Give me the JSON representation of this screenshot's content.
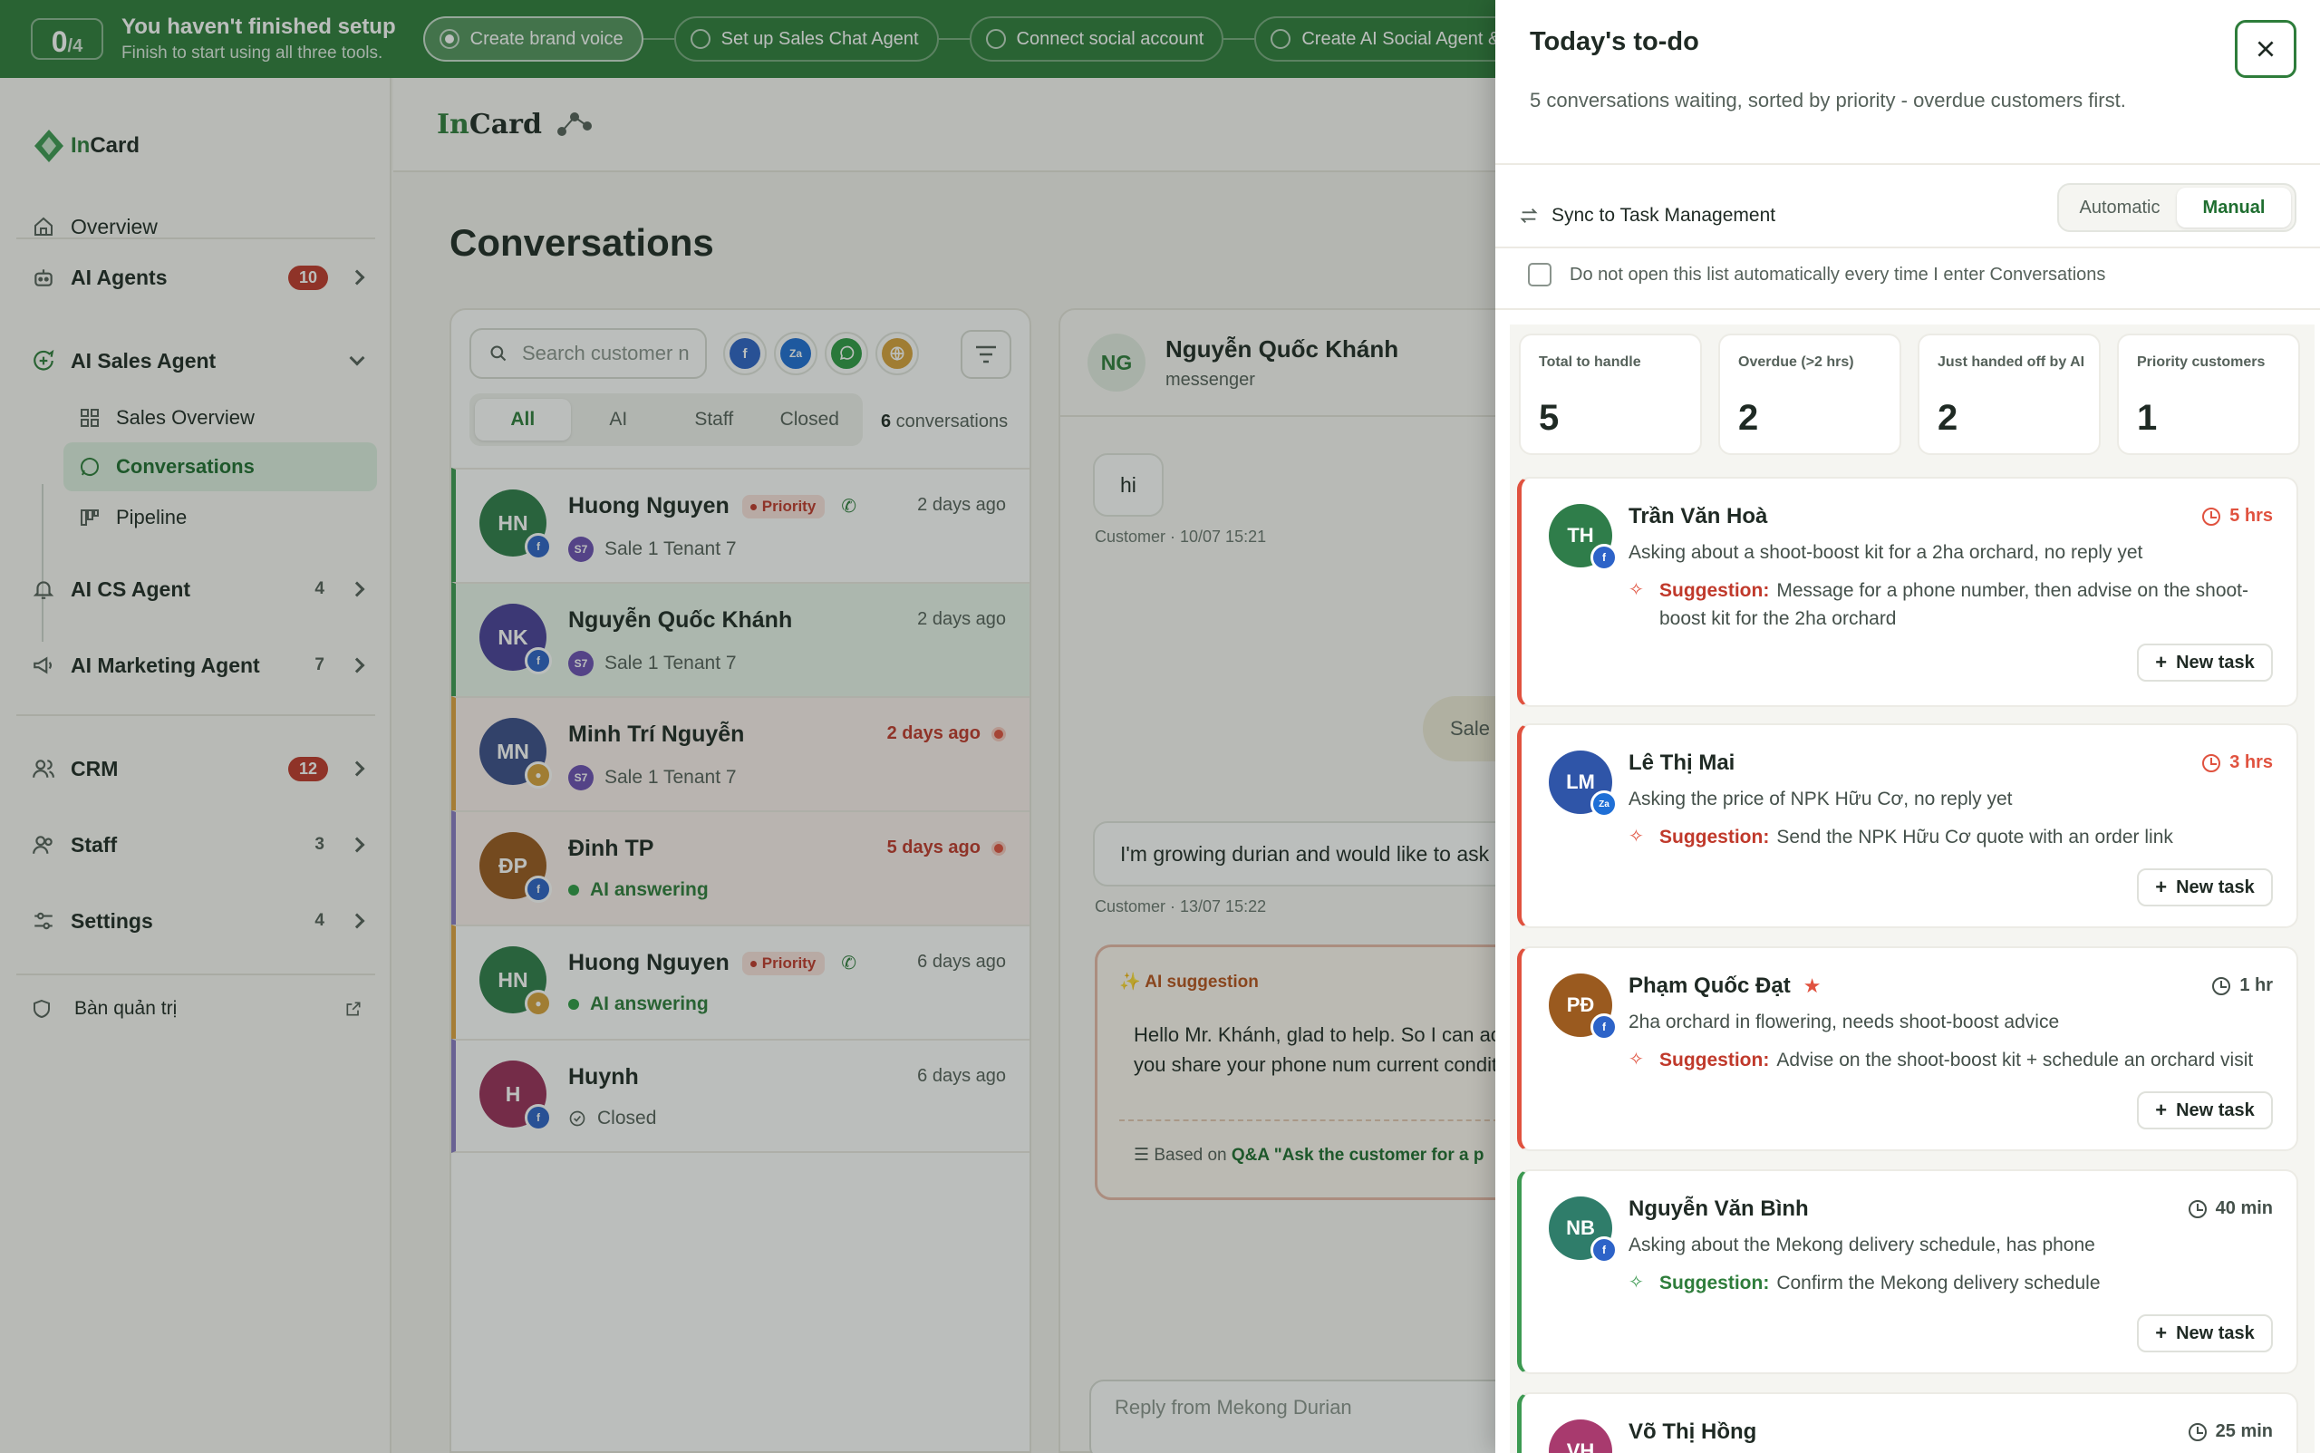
{
  "setup": {
    "count": "0",
    "total": "/4",
    "title": "You haven't finished setup",
    "subtitle": "Finish to start using all three tools.",
    "steps": [
      {
        "label": "Create brand voice",
        "active": true
      },
      {
        "label": "Set up Sales Chat Agent",
        "active": false
      },
      {
        "label": "Connect social account",
        "active": false
      },
      {
        "label": "Create AI Social Agent & ...",
        "active": false
      }
    ]
  },
  "brand": {
    "prefix": "In",
    "suffix": "Card"
  },
  "sidebar": {
    "overview": "Overview",
    "ai_agents": {
      "label": "AI Agents",
      "badge": "10"
    },
    "ai_sales_agent": {
      "label": "AI Sales Agent"
    },
    "sub_items": [
      "Sales Overview",
      "Conversations",
      "Pipeline"
    ],
    "ai_cs_agent": {
      "label": "AI CS Agent",
      "count": "4"
    },
    "ai_marketing_agent": {
      "label": "AI Marketing Agent",
      "count": "7"
    },
    "crm": {
      "label": "CRM",
      "badge": "12"
    },
    "staff": {
      "label": "Staff",
      "count": "3"
    },
    "settings": {
      "label": "Settings",
      "count": "4"
    },
    "admin": "Bàn quản trị"
  },
  "main": {
    "logo_prefix": "In",
    "logo_suffix": "Card",
    "title": "Conversations"
  },
  "list": {
    "search_placeholder": "Search customer n",
    "channels": [
      "f",
      "Za",
      "whatsapp",
      "web"
    ],
    "tabs": [
      "All",
      "AI",
      "Staff",
      "Closed"
    ],
    "active_tab": "All",
    "count_num": "6",
    "count_label": " conversations",
    "items": [
      {
        "initials": "HN",
        "name": "Huong Nguyen",
        "priority": "Priority",
        "time": "2 days ago",
        "sub": "Sale 1 Tenant 7",
        "channel": "f"
      },
      {
        "initials": "NK",
        "name": "Nguyễn Quốc Khánh",
        "priority": "",
        "time": "2 days ago",
        "sub": "Sale 1 Tenant 7",
        "channel": "f"
      },
      {
        "initials": "MN",
        "name": "Minh Trí Nguyễn",
        "priority": "",
        "time": "2 days ago",
        "sub": "Sale 1 Tenant 7",
        "channel": "web"
      },
      {
        "initials": "ĐP",
        "name": "Đinh TP",
        "priority": "",
        "time": "5 days ago",
        "sub": "AI answering",
        "channel": "f"
      },
      {
        "initials": "HN",
        "name": "Huong Nguyen",
        "priority": "Priority",
        "time": "6 days ago",
        "sub": "AI answering",
        "channel": "web"
      },
      {
        "initials": "H",
        "name": "Huynh",
        "priority": "",
        "time": "6 days ago",
        "sub": "Closed",
        "channel": "f"
      }
    ]
  },
  "chat": {
    "initials": "NG",
    "name": "Nguyễn Quốc Khánh",
    "channel": "messenger",
    "msg1": "hi",
    "meta1": "Customer · 10/07 15:21",
    "sale_bubble": "Sale",
    "msg2": "I'm growing durian and would like to ask h",
    "meta2": "Customer · 13/07 15:22",
    "ai_label": "AI suggestion",
    "ai_text": "Hello Mr. Khánh, glad to help. So I can ac orchard, could you share your phone num current condition, even better.",
    "based_prefix": "Based on ",
    "based_link": "Q&A \"Ask the customer for a p",
    "reply_placeholder": "Reply from Mekong Durian"
  },
  "drawer": {
    "title": "Today's to-do",
    "subtitle": "5 conversations waiting, sorted by priority - overdue customers first.",
    "sync_label": "Sync to Task Management",
    "mode_auto": "Automatic",
    "mode_manual": "Manual",
    "checkbox_label": "Do not open this list automatically every time I enter Conversations",
    "stats": [
      {
        "label": "Total to handle",
        "value": "5"
      },
      {
        "label": "Overdue (>2 hrs)",
        "value": "2"
      },
      {
        "label": "Just handed off by AI",
        "value": "2"
      },
      {
        "label": "Priority customers",
        "value": "1"
      }
    ],
    "suggestion_label": "Suggestion:",
    "new_task": "New task",
    "cards": [
      {
        "initials": "TH",
        "name": "Trần Văn Hoà",
        "star": false,
        "time": "5 hrs",
        "desc": "Asking about a shoot-boost kit for a 2ha orchard, no reply yet",
        "suggestion": "Message for a phone number, then advise on the shoot-boost kit for the 2ha orchard",
        "channel": "f"
      },
      {
        "initials": "LM",
        "name": "Lê Thị Mai",
        "star": false,
        "time": "3 hrs",
        "desc": "Asking the price of NPK Hữu Cơ, no reply yet",
        "suggestion": "Send the NPK Hữu Cơ quote with an order link",
        "channel": "Za"
      },
      {
        "initials": "PĐ",
        "name": "Phạm Quốc Đạt",
        "star": true,
        "time": "1 hr",
        "desc": "2ha orchard in flowering, needs shoot-boost advice",
        "suggestion": "Advise on the shoot-boost kit + schedule an orchard visit",
        "channel": "f"
      },
      {
        "initials": "NB",
        "name": "Nguyễn Văn Bình",
        "star": false,
        "time": "40 min",
        "desc": "Asking about the Mekong delivery schedule, has phone",
        "suggestion": "Confirm the Mekong delivery schedule",
        "channel": "f"
      },
      {
        "initials": "VH",
        "name": "Võ Thị Hồng",
        "star": false,
        "time": "25 min",
        "desc": "",
        "suggestion": "",
        "channel": "f"
      }
    ]
  },
  "colors": {
    "brand_green": "#2e7d3b",
    "urgent": "#e0523f",
    "priority_red": "#c0392b",
    "normal_accent": "#3d9a52"
  }
}
